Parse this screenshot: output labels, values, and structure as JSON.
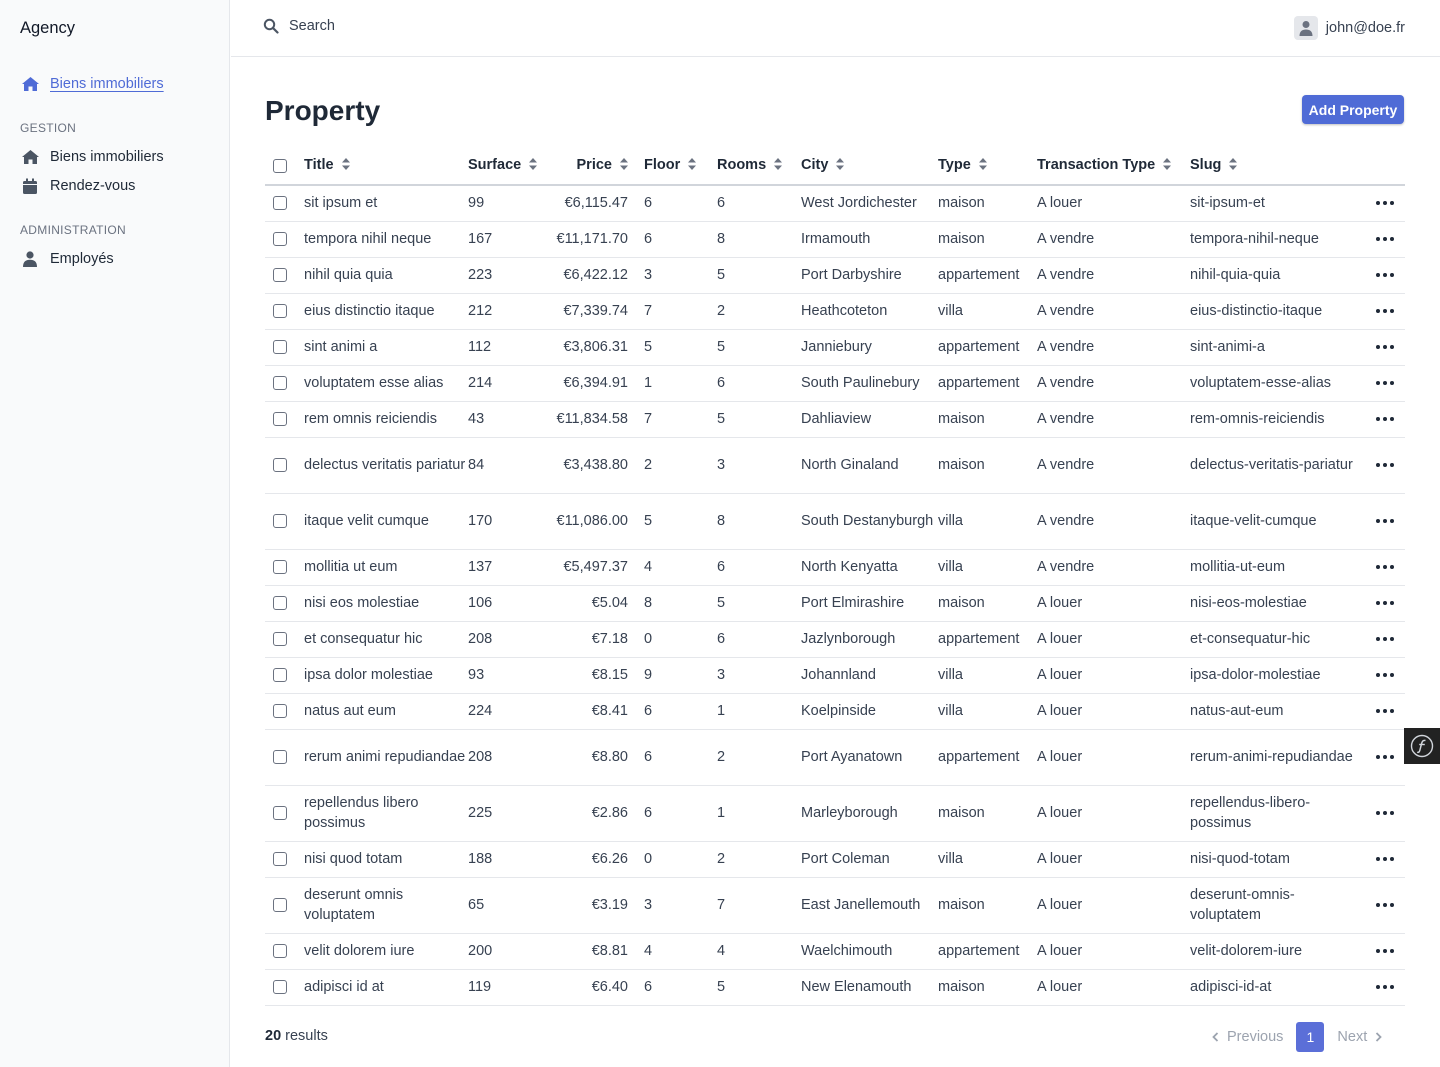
{
  "app": {
    "brand": "Agency"
  },
  "sidebar": {
    "active_item": {
      "label": "Biens immobiliers",
      "icon": "home-icon"
    },
    "sections": [
      {
        "title": "GESTION",
        "items": [
          {
            "label": "Biens immobiliers",
            "icon": "home-icon"
          },
          {
            "label": "Rendez-vous",
            "icon": "calendar-icon"
          }
        ]
      },
      {
        "title": "ADMINISTRATION",
        "items": [
          {
            "label": "Employés",
            "icon": "user-icon"
          }
        ]
      }
    ]
  },
  "topbar": {
    "search_label": "Search",
    "user_email": "john@doe.fr"
  },
  "page": {
    "title": "Property",
    "add_button": "Add Property"
  },
  "table": {
    "columns": [
      "Title",
      "Surface",
      "Price",
      "Floor",
      "Rooms",
      "City",
      "Type",
      "Transaction Type",
      "Slug"
    ],
    "rows": [
      {
        "title": "sit ipsum et",
        "surface": "99",
        "price": "€6,115.47",
        "floor": "6",
        "rooms": "6",
        "city": "West Jordichester",
        "type": "maison",
        "transaction": "A louer",
        "slug": "sit-ipsum-et"
      },
      {
        "title": "tempora nihil neque",
        "surface": "167",
        "price": "€11,171.70",
        "floor": "6",
        "rooms": "8",
        "city": "Irmamouth",
        "type": "maison",
        "transaction": "A vendre",
        "slug": "tempora-nihil-neque"
      },
      {
        "title": "nihil quia quia",
        "surface": "223",
        "price": "€6,422.12",
        "floor": "3",
        "rooms": "5",
        "city": "Port Darbyshire",
        "type": "appartement",
        "transaction": "A vendre",
        "slug": "nihil-quia-quia"
      },
      {
        "title": "eius distinctio itaque",
        "surface": "212",
        "price": "€7,339.74",
        "floor": "7",
        "rooms": "2",
        "city": "Heathcoteton",
        "type": "villa",
        "transaction": "A vendre",
        "slug": "eius-distinctio-itaque"
      },
      {
        "title": "sint animi a",
        "surface": "112",
        "price": "€3,806.31",
        "floor": "5",
        "rooms": "5",
        "city": "Janniebury",
        "type": "appartement",
        "transaction": "A vendre",
        "slug": "sint-animi-a"
      },
      {
        "title": "voluptatem esse alias",
        "surface": "214",
        "price": "€6,394.91",
        "floor": "1",
        "rooms": "6",
        "city": "South Paulinebury",
        "type": "appartement",
        "transaction": "A vendre",
        "slug": "voluptatem-esse-alias"
      },
      {
        "title": "rem omnis reiciendis",
        "surface": "43",
        "price": "€11,834.58",
        "floor": "7",
        "rooms": "5",
        "city": "Dahliaview",
        "type": "maison",
        "transaction": "A vendre",
        "slug": "rem-omnis-reiciendis"
      },
      {
        "title": "delectus veritatis pariatur",
        "surface": "84",
        "price": "€3,438.80",
        "floor": "2",
        "rooms": "3",
        "city": "North Ginaland",
        "type": "maison",
        "transaction": "A vendre",
        "slug": "delectus-veritatis-pariatur"
      },
      {
        "title": "itaque velit cumque",
        "surface": "170",
        "price": "€11,086.00",
        "floor": "5",
        "rooms": "8",
        "city": "South Destanyburgh",
        "type": "villa",
        "transaction": "A vendre",
        "slug": "itaque-velit-cumque"
      },
      {
        "title": "mollitia ut eum",
        "surface": "137",
        "price": "€5,497.37",
        "floor": "4",
        "rooms": "6",
        "city": "North Kenyatta",
        "type": "villa",
        "transaction": "A vendre",
        "slug": "mollitia-ut-eum"
      },
      {
        "title": "nisi eos molestiae",
        "surface": "106",
        "price": "€5.04",
        "floor": "8",
        "rooms": "5",
        "city": "Port Elmirashire",
        "type": "maison",
        "transaction": "A louer",
        "slug": "nisi-eos-molestiae"
      },
      {
        "title": "et consequatur hic",
        "surface": "208",
        "price": "€7.18",
        "floor": "0",
        "rooms": "6",
        "city": "Jazlynborough",
        "type": "appartement",
        "transaction": "A louer",
        "slug": "et-consequatur-hic"
      },
      {
        "title": "ipsa dolor molestiae",
        "surface": "93",
        "price": "€8.15",
        "floor": "9",
        "rooms": "3",
        "city": "Johannland",
        "type": "villa",
        "transaction": "A louer",
        "slug": "ipsa-dolor-molestiae"
      },
      {
        "title": "natus aut eum",
        "surface": "224",
        "price": "€8.41",
        "floor": "6",
        "rooms": "1",
        "city": "Koelpinside",
        "type": "villa",
        "transaction": "A louer",
        "slug": "natus-aut-eum"
      },
      {
        "title": "rerum animi repudiandae",
        "surface": "208",
        "price": "€8.80",
        "floor": "6",
        "rooms": "2",
        "city": "Port Ayanatown",
        "type": "appartement",
        "transaction": "A louer",
        "slug": "rerum-animi-repudiandae"
      },
      {
        "title": "repellendus libero possimus",
        "surface": "225",
        "price": "€2.86",
        "floor": "6",
        "rooms": "1",
        "city": "Marleyborough",
        "type": "maison",
        "transaction": "A louer",
        "slug": "repellendus-libero-possimus"
      },
      {
        "title": "nisi quod totam",
        "surface": "188",
        "price": "€6.26",
        "floor": "0",
        "rooms": "2",
        "city": "Port Coleman",
        "type": "villa",
        "transaction": "A louer",
        "slug": "nisi-quod-totam"
      },
      {
        "title": "deserunt omnis voluptatem",
        "surface": "65",
        "price": "€3.19",
        "floor": "3",
        "rooms": "7",
        "city": "East Janellemouth",
        "type": "maison",
        "transaction": "A louer",
        "slug": "deserunt-omnis-voluptatem"
      },
      {
        "title": "velit dolorem iure",
        "surface": "200",
        "price": "€8.81",
        "floor": "4",
        "rooms": "4",
        "city": "Waelchimouth",
        "type": "appartement",
        "transaction": "A louer",
        "slug": "velit-dolorem-iure"
      },
      {
        "title": "adipisci id at",
        "surface": "119",
        "price": "€6.40",
        "floor": "6",
        "rooms": "5",
        "city": "New Elenamouth",
        "type": "maison",
        "transaction": "A louer",
        "slug": "adipisci-id-at"
      }
    ]
  },
  "footer": {
    "results_count": "20",
    "results_label": " results",
    "prev_label": "Previous",
    "current_page": "1",
    "next_label": "Next"
  },
  "colors": {
    "accent": "#4f6bd6",
    "border": "#e5e7eb",
    "sidebar_bg": "#f9fafb"
  },
  "debug_toolbar_icon": "symfony-icon"
}
